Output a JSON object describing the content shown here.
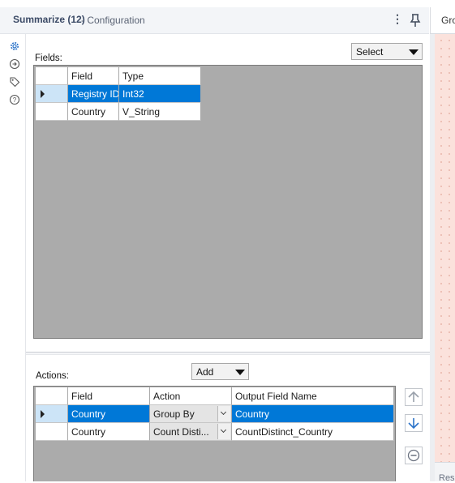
{
  "header": {
    "title": "Summarize (12)",
    "subtitle": "- Configuration",
    "menu_icon": "kebab-menu-icon",
    "pin_icon": "pin-icon"
  },
  "right_panel": {
    "tab_label": "Gro",
    "bottom_label": "Resu",
    "canvas_color": "#fbe2dc"
  },
  "rail": {
    "icons": [
      "gear-icon",
      "circle-arrow-icon",
      "tag-icon",
      "help-icon"
    ]
  },
  "fields": {
    "label": "Fields:",
    "select_label": "Select",
    "columns": [
      "Field",
      "Type"
    ],
    "rows": [
      {
        "field": "Registry ID",
        "type": "Int32",
        "selected": true
      },
      {
        "field": "Country",
        "type": "V_String",
        "selected": false
      }
    ]
  },
  "actions": {
    "label": "Actions:",
    "add_label": "Add",
    "columns": [
      "Field",
      "Action",
      "Output Field Name"
    ],
    "rows": [
      {
        "field": "Country",
        "action": "Group By",
        "output": "Country",
        "selected": true
      },
      {
        "field": "Country",
        "action": "Count Disti...",
        "output": "CountDistinct_Country",
        "selected": false
      }
    ],
    "side_buttons": [
      "move-up-icon",
      "move-down-icon",
      "remove-icon"
    ]
  },
  "colors": {
    "selection": "#0078d7",
    "grid_background": "#ababab",
    "title_color": "#3b4a66"
  }
}
